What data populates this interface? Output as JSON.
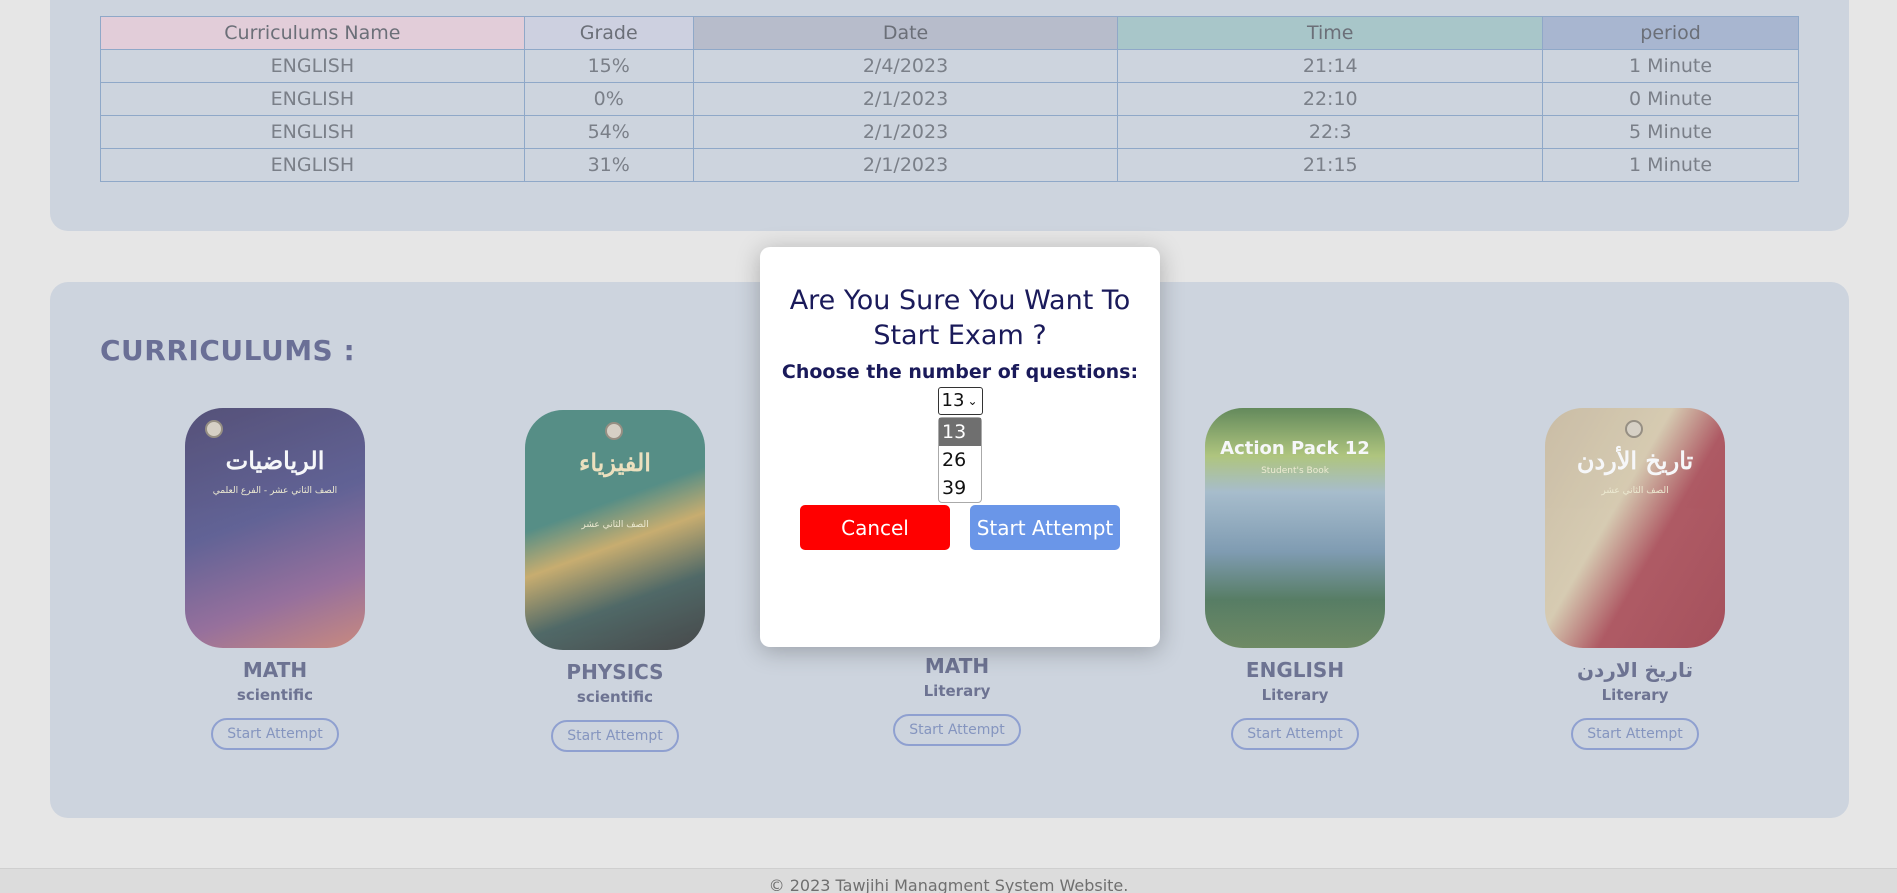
{
  "history": {
    "columns": [
      "Curriculums Name",
      "Grade",
      "Date",
      "Time",
      "period"
    ],
    "header_colors": [
      "#e2cdd9",
      "#cdd0e0",
      "#b7bccb",
      "#a8c6c9",
      "#a8b6d0"
    ],
    "rows": [
      [
        "ENGLISH",
        "15%",
        "2/4/2023",
        "21:14",
        "1 Minute"
      ],
      [
        "ENGLISH",
        "0%",
        "2/1/2023",
        "22:10",
        "0 Minute"
      ],
      [
        "ENGLISH",
        "54%",
        "2/1/2023",
        "22:3",
        "5 Minute"
      ],
      [
        "ENGLISH",
        "31%",
        "2/1/2023",
        "21:15",
        "1 Minute"
      ]
    ]
  },
  "curriculums": {
    "title": "CURRICULUMS :",
    "cards": [
      {
        "cover_title": "الرياضيات",
        "cover_sub": "الصف الثاني عشر - الفرع العلمي",
        "cover_color": "#4a3d6a",
        "name": "MATH",
        "track": "scientific",
        "button": "Start Attempt"
      },
      {
        "cover_title": "الفيزياء",
        "cover_sub": "الصف الثاني عشر",
        "cover_color": "#3f7f76",
        "name": "PHYSICS",
        "track": "scientific",
        "button": "Start Attempt"
      },
      {
        "cover_title": "",
        "cover_sub": "",
        "cover_color": "#cdd4de",
        "name": "MATH",
        "track": "Literary",
        "button": "Start Attempt"
      },
      {
        "cover_title": "Action Pack 12",
        "cover_sub": "Student's Book",
        "cover_color": "#4e7a6e",
        "name": "ENGLISH",
        "track": "Literary",
        "button": "Start Attempt"
      },
      {
        "cover_title": "تاريخ الأردن",
        "cover_sub": "الصف الثاني عشر",
        "cover_color": "#a8404a",
        "name": "تاريخ الاردن",
        "track": "Literary",
        "button": "Start Attempt"
      }
    ]
  },
  "modal": {
    "title": "Are You Sure You Want To Start Exam ?",
    "choose_label": "Choose the number of questions:",
    "selected_value": "13",
    "options": [
      "13",
      "26",
      "39"
    ],
    "cancel_label": "Cancel",
    "start_label": "Start Attempt"
  },
  "footer": {
    "text": "© 2023 Tawjihi Managment System Website."
  }
}
